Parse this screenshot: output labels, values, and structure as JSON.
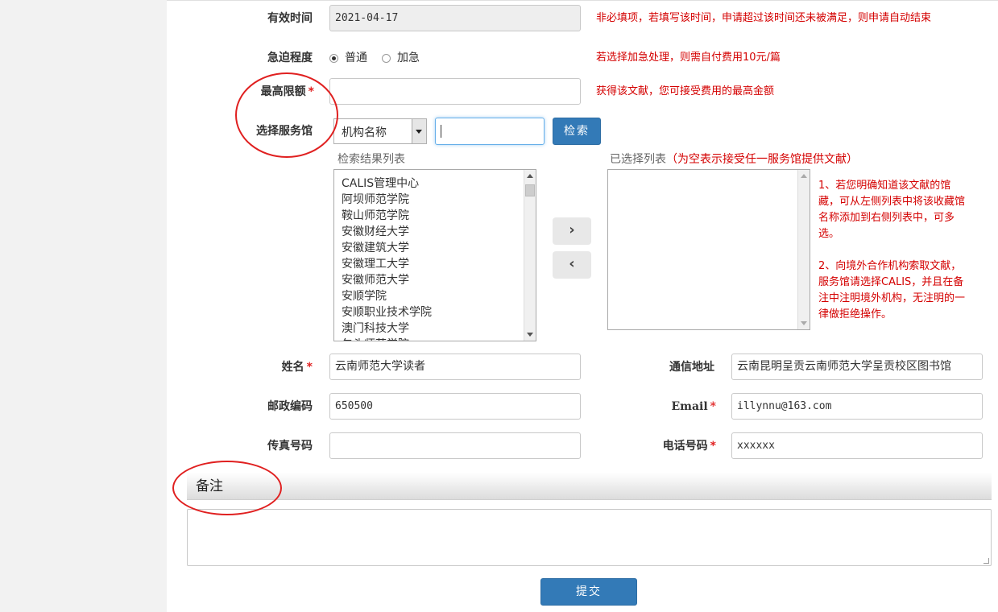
{
  "form": {
    "valid_time": {
      "label": "有效时间",
      "value": "2021-04-17",
      "hint": "非必填项，若填写该时间，申请超过该时间还未被满足，则申请自动结束"
    },
    "urgency": {
      "label": "急迫程度",
      "options": [
        "普通",
        "加急"
      ],
      "selected": "普通",
      "hint": "若选择加急处理，则需自付费用10元/篇"
    },
    "max_limit": {
      "label": "最高限额",
      "required_mark": "*",
      "value": "",
      "hint": "获得该文献，您可接受费用的最高金额"
    },
    "service_library": {
      "label": "选择服务馆",
      "select_value": "机构名称",
      "search_value": "",
      "search_button": "检索",
      "results_title": "检索结果列表",
      "results": [
        "CALIS管理中心",
        "阿坝师范学院",
        "鞍山师范学院",
        "安徽财经大学",
        "安徽建筑大学",
        "安徽理工大学",
        "安徽师范大学",
        "安顺学院",
        "安顺职业技术学院",
        "澳门科技大学",
        "包头师范学院"
      ],
      "add_button": "›",
      "remove_button": "‹",
      "selected_title": "已选择列表",
      "selected_note": "（为空表示接受任一服务馆提供文献）",
      "selected": [],
      "hint1": "1、若您明确知道该文献的馆藏，可从左侧列表中将该收藏馆名称添加到右侧列表中，可多选。",
      "hint2": "2、向境外合作机构索取文献，服务馆请选择CALIS，并且在备注中注明境外机构，无注明的一律做拒绝操作。"
    },
    "name": {
      "label": "姓名",
      "required_mark": "*",
      "value": "云南师范大学读者"
    },
    "address": {
      "label": "通信地址",
      "value": "云南昆明呈贡云南师范大学呈贡校区图书馆"
    },
    "postcode": {
      "label": "邮政编码",
      "value": "650500"
    },
    "email": {
      "label": "Email",
      "required_mark": "*",
      "value": "illynnu@163.com"
    },
    "fax": {
      "label": "传真号码",
      "value": ""
    },
    "phone": {
      "label": "电话号码",
      "required_mark": "*",
      "value": "xxxxxx"
    },
    "remark": {
      "title": "备注",
      "value": ""
    },
    "submit": "提交"
  },
  "colors": {
    "accent": "#337ab7",
    "hint": "#d40000",
    "annotation": "#e02020"
  }
}
